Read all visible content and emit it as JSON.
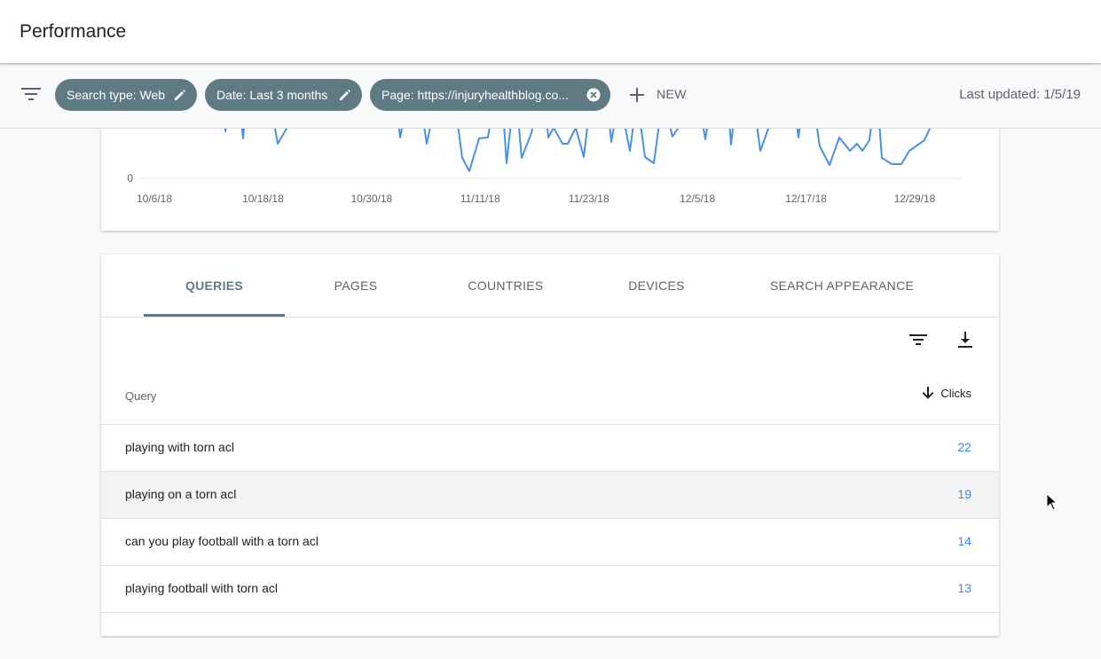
{
  "header": {
    "title": "Performance"
  },
  "filters": {
    "chips": [
      {
        "label": "Search type: Web",
        "icon": "pencil-icon"
      },
      {
        "label": "Date: Last 3 months",
        "icon": "pencil-icon"
      },
      {
        "label": "Page: https://injuryhealthblog.co...",
        "icon": "close-circle-icon"
      }
    ],
    "new_label": "NEW",
    "last_updated": "Last updated: 1/5/19"
  },
  "chart_data": {
    "type": "line",
    "x_ticks": [
      "10/6/18",
      "10/18/18",
      "10/30/18",
      "11/11/18",
      "11/23/18",
      "12/5/18",
      "12/17/18",
      "12/29/18"
    ],
    "y_ticks": [
      "0"
    ],
    "series_color": "#4a90e2",
    "note_visible_portion": "bottom of chart only; values clipped above"
  },
  "tabs": [
    "QUERIES",
    "PAGES",
    "COUNTRIES",
    "DEVICES",
    "SEARCH APPEARANCE"
  ],
  "active_tab": "QUERIES",
  "table": {
    "columns": {
      "query": "Query",
      "clicks": "Clicks"
    },
    "rows": [
      {
        "query": "playing with torn acl",
        "clicks": "22"
      },
      {
        "query": "playing on a torn acl",
        "clicks": "19"
      },
      {
        "query": "can you play football with a torn acl",
        "clicks": "14"
      },
      {
        "query": "playing football with torn acl",
        "clicks": "13"
      }
    ]
  },
  "colors": {
    "chip": "#5f7a82",
    "accent_link": "#4285f4",
    "line": "#4a90e2"
  }
}
